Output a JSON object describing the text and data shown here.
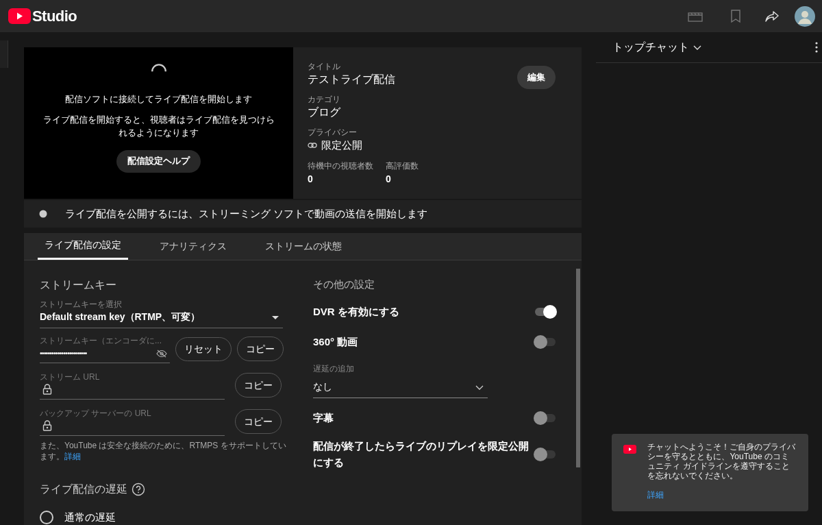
{
  "header": {
    "logo_text": "Studio"
  },
  "preview": {
    "message": "配信ソフトに接続してライブ配信を開始します",
    "sub_message": "ライブ配信を開始すると、視聴者はライブ配信を見つけられるようになります",
    "help_button": "配信設定ヘルプ"
  },
  "info": {
    "edit_button": "編集",
    "fields": [
      {
        "label": "タイトル",
        "value": "テストライブ配信",
        "kind": "plain"
      },
      {
        "label": "カテゴリ",
        "value": "ブログ",
        "kind": "plain"
      },
      {
        "label": "プライバシー",
        "value": "限定公開",
        "kind": "link"
      }
    ],
    "stats": [
      {
        "label": "待機中の視聴者数",
        "value": "0"
      },
      {
        "label": "高評価数",
        "value": "0"
      }
    ]
  },
  "status": {
    "text": "ライブ配信を公開するには、ストリーミング ソフトで動画の送信を開始します"
  },
  "tabs": [
    {
      "label": "ライブ配信の設定",
      "selected": true
    },
    {
      "label": "アナリティクス",
      "selected": false
    },
    {
      "label": "ストリームの状態",
      "selected": false
    }
  ],
  "stream_key": {
    "heading": "ストリームキー",
    "select": {
      "label": "ストリームキーを選択",
      "value": "Default stream key（RTMP、可変）"
    },
    "key_field": {
      "label": "ストリームキー（エンコーダに...",
      "value": "••••••••••••••••••••••••",
      "reset_button": "リセット",
      "copy_button": "コピー"
    },
    "url_fields": [
      {
        "label": "ストリーム URL",
        "copy_button": "コピー"
      },
      {
        "label": "バックアップ サーバーの URL",
        "copy_button": "コピー"
      }
    ],
    "note": "また、YouTube は安全な接続のために、RTMPS をサポートしています。",
    "note_link": "詳細"
  },
  "latency": {
    "heading": "ライブ配信の遅延",
    "options": [
      {
        "label": "通常の遅延",
        "selected": false
      }
    ]
  },
  "other_settings": {
    "heading": "その他の設定",
    "items": [
      {
        "kind": "toggle",
        "label": "DVR を有効にする",
        "on": true
      },
      {
        "kind": "toggle",
        "label": "360° 動画",
        "on": false
      },
      {
        "kind": "select",
        "label": "遅延の追加",
        "value": "なし"
      },
      {
        "kind": "toggle",
        "label": "字幕",
        "on": false
      },
      {
        "kind": "toggle",
        "label": "配信が終了したらライブのリプレイを限定公開にする",
        "on": false
      }
    ]
  },
  "chat": {
    "title": "トップチャット",
    "welcome": {
      "text": "チャットへようこそ！ご自身のプライバシーを守るとともに、YouTube のコミュニティ ガイドラインを遵守することを忘れないでください。",
      "link": "詳細"
    }
  }
}
